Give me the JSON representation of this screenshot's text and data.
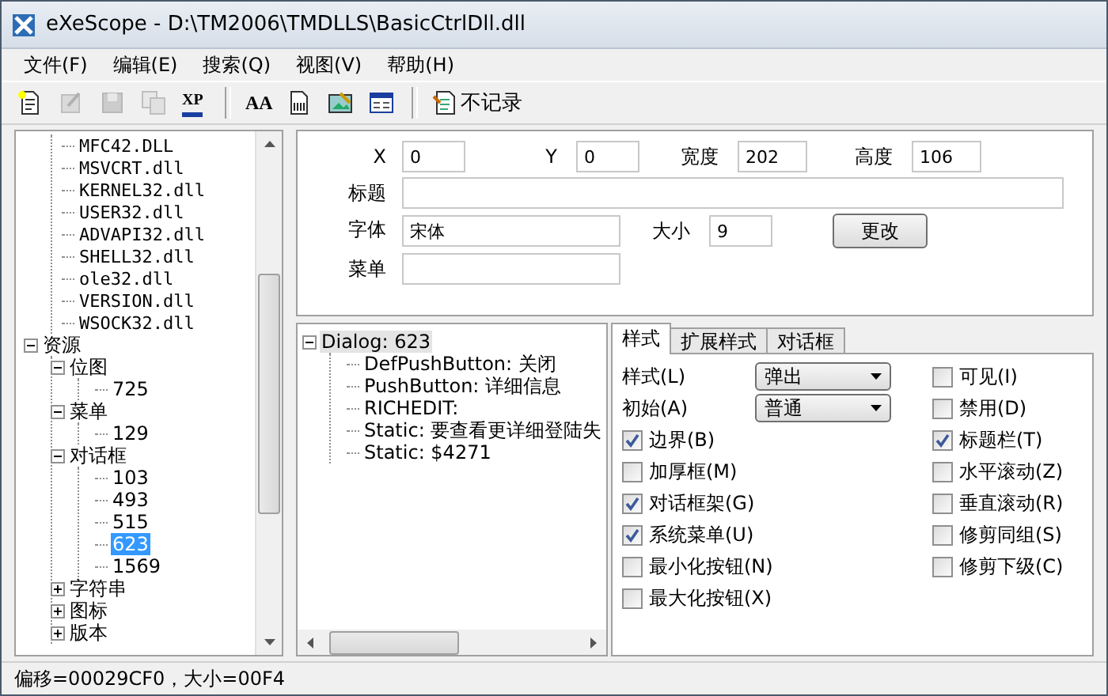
{
  "window": {
    "title": "eXeScope - D:\\TM2006\\TMDLLS\\BasicCtrlDll.dll"
  },
  "menu": [
    "文件(F)",
    "编辑(E)",
    "搜索(Q)",
    "视图(V)",
    "帮助(H)"
  ],
  "toolbar": [
    {
      "kind": "new",
      "disabled": false
    },
    {
      "kind": "edit",
      "disabled": true
    },
    {
      "kind": "save",
      "disabled": true
    },
    {
      "kind": "copy",
      "disabled": true
    },
    {
      "kind": "text",
      "label": "XP",
      "disabled": false
    },
    {
      "kind": "sep"
    },
    {
      "kind": "text",
      "label": "AA",
      "disabled": false
    },
    {
      "kind": "hex",
      "disabled": false
    },
    {
      "kind": "image",
      "disabled": false
    },
    {
      "kind": "window",
      "disabled": false
    },
    {
      "kind": "sep"
    },
    {
      "kind": "log",
      "label": "不记录",
      "disabled": false
    }
  ],
  "tree": {
    "items": [
      {
        "children": [
          {
            "label": "MFC42.DLL",
            "selected": false
          },
          {
            "label": "MSVCRT.dll",
            "selected": false
          },
          {
            "label": "KERNEL32.dll",
            "selected": false
          },
          {
            "label": "USER32.dll",
            "selected": false
          },
          {
            "label": "ADVAPI32.dll",
            "selected": false
          },
          {
            "label": "SHELL32.dll",
            "selected": false
          },
          {
            "label": "ole32.dll",
            "selected": false
          },
          {
            "label": "VERSION.dll",
            "selected": false
          },
          {
            "label": "WSOCK32.dll",
            "selected": false
          }
        ]
      },
      {
        "label": "资源",
        "selected": false,
        "expanded": true,
        "children": [
          {
            "label": "位图",
            "selected": false,
            "expanded": true,
            "children": [
              {
                "label": "725",
                "selected": false
              }
            ]
          },
          {
            "label": "菜单",
            "selected": false,
            "expanded": true,
            "children": [
              {
                "label": "129",
                "selected": false
              }
            ]
          },
          {
            "label": "对话框",
            "selected": false,
            "expanded": true,
            "children": [
              {
                "label": "103",
                "selected": false
              },
              {
                "label": "493",
                "selected": false
              },
              {
                "label": "515",
                "selected": false
              },
              {
                "label": "623",
                "selected": true
              },
              {
                "label": "1569",
                "selected": false
              }
            ]
          },
          {
            "label": "字符串",
            "selected": false,
            "expanded": false
          },
          {
            "label": "图标",
            "selected": false,
            "expanded": false
          },
          {
            "label": "版本",
            "selected": false,
            "expanded": false
          }
        ]
      }
    ]
  },
  "properties": {
    "position": [
      {
        "label": "X",
        "value": "0"
      },
      {
        "label": "Y",
        "value": "0"
      },
      {
        "label": "宽度",
        "value": "202"
      },
      {
        "label": "高度",
        "value": "106"
      }
    ],
    "caption": {
      "label": "标题"
    },
    "font": {
      "label": "字体",
      "value": "宋体"
    },
    "size": {
      "label": "大小",
      "value": "9"
    },
    "change_button": "更改",
    "menu": {
      "label": "菜单"
    }
  },
  "controls": {
    "items": [
      {
        "label": "Dialog: 623",
        "selected": true,
        "expanded": true,
        "children": [
          {
            "label": "DefPushButton: 关闭",
            "selected": false
          },
          {
            "label": "PushButton: 详细信息",
            "selected": false
          },
          {
            "label": "RICHEDIT:",
            "selected": false
          },
          {
            "label": "Static: 要查看更详细登陆失",
            "selected": false
          },
          {
            "label": "Static: $4271",
            "selected": false
          }
        ]
      }
    ]
  },
  "tabs": [
    {
      "label": "样式",
      "selected": true
    },
    {
      "label": "扩展样式",
      "selected": false
    },
    {
      "label": "对话框",
      "selected": false
    }
  ],
  "style": {
    "dropdowns": [
      {
        "label": "样式(L)",
        "value": "弹出"
      },
      {
        "label": "初始(A)",
        "value": "普通"
      }
    ],
    "left_checks": [
      {
        "label": "边界(B)",
        "checked": true
      },
      {
        "label": "加厚框(M)",
        "checked": false
      },
      {
        "label": "对话框架(G)",
        "checked": true
      },
      {
        "label": "系统菜单(U)",
        "checked": true
      },
      {
        "label": "最小化按钮(N)",
        "checked": false
      },
      {
        "label": "最大化按钮(X)",
        "checked": false
      }
    ],
    "right_checks": [
      {
        "label": "可见(I)",
        "checked": false
      },
      {
        "label": "禁用(D)",
        "checked": false
      },
      {
        "label": "标题栏(T)",
        "checked": true
      },
      {
        "label": "水平滚动(Z)",
        "checked": false
      },
      {
        "label": "垂直滚动(R)",
        "checked": false
      },
      {
        "label": "修剪同组(S)",
        "checked": false
      },
      {
        "label": "修剪下级(C)",
        "checked": false
      }
    ]
  },
  "status_bar": "偏移=00029CF0，大小=00F4"
}
